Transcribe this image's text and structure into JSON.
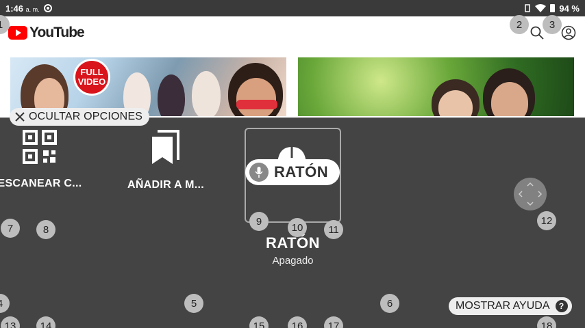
{
  "status_bar": {
    "time": "1:46",
    "ampm": "a. m.",
    "battery": "94 %"
  },
  "youtube": {
    "logo_text": "YouTube"
  },
  "thumbnails": {
    "first_badge_line1": "FULL",
    "first_badge_line2": "VIDEO"
  },
  "overlay": {
    "hide_options_label": "OCULTAR OPCIONES",
    "options": {
      "scan": "ESCANEAR C...",
      "add": "AÑADIR A M...",
      "mouse_pill": "RATÓN",
      "mouse_title": "RATÓN",
      "mouse_status": "Apagado"
    },
    "help_label": "MOSTRAR AYUDA",
    "help_icon": "?"
  },
  "badges": {
    "b1": "1",
    "b2": "2",
    "b3": "3",
    "b4": "4",
    "b5": "5",
    "b6": "6",
    "b7": "7",
    "b8": "8",
    "b9": "9",
    "b10": "10",
    "b11": "11",
    "b12": "12",
    "b13": "13",
    "b14": "14",
    "b15": "15",
    "b16": "16",
    "b17": "17",
    "b18": "18"
  }
}
